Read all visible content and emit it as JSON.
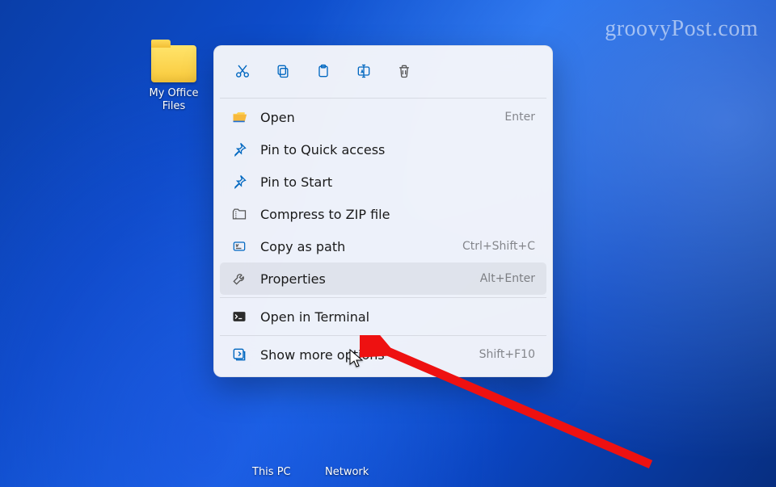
{
  "watermark": "groovyPost.com",
  "desktop": {
    "folder_label": "My Office Files",
    "this_pc": "This PC",
    "network": "Network"
  },
  "menu": {
    "toolbar": [
      {
        "name": "cut-icon"
      },
      {
        "name": "copy-icon"
      },
      {
        "name": "paste-icon"
      },
      {
        "name": "rename-icon"
      },
      {
        "name": "delete-icon"
      }
    ],
    "items": [
      {
        "id": "open",
        "label": "Open",
        "accel": "Enter",
        "highlight": false
      },
      {
        "id": "pin-quick",
        "label": "Pin to Quick access",
        "accel": "",
        "highlight": false
      },
      {
        "id": "pin-start",
        "label": "Pin to Start",
        "accel": "",
        "highlight": false
      },
      {
        "id": "zip",
        "label": "Compress to ZIP file",
        "accel": "",
        "highlight": false
      },
      {
        "id": "copy-path",
        "label": "Copy as path",
        "accel": "Ctrl+Shift+C",
        "highlight": false
      },
      {
        "id": "properties",
        "label": "Properties",
        "accel": "Alt+Enter",
        "highlight": true
      },
      {
        "sep": true
      },
      {
        "id": "terminal",
        "label": "Open in Terminal",
        "accel": "",
        "highlight": false
      },
      {
        "sep": true
      },
      {
        "id": "more",
        "label": "Show more options",
        "accel": "Shift+F10",
        "highlight": false
      }
    ]
  }
}
